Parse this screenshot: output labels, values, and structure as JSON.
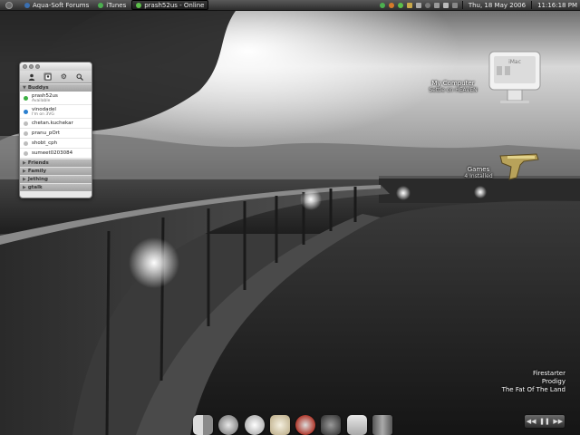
{
  "taskbar": {
    "tasks": [
      {
        "label": "",
        "icon": "gnome-menu-icon",
        "active": false
      },
      {
        "label": "Aqua-Soft Forums",
        "icon": "browser-icon",
        "active": false
      },
      {
        "label": "iTunes",
        "icon": "itunes-icon",
        "active": false
      },
      {
        "label": "prash52us - Online",
        "icon": "messenger-icon",
        "active": true
      }
    ],
    "tray_icons": [
      "network-icon",
      "firefox-icon",
      "messenger-tray-icon",
      "folder-icon",
      "speaker-icon",
      "dashboard-icon",
      "phone-icon",
      "volume-icon",
      "battery-icon"
    ],
    "date": "Thu, 18 May 2006",
    "time": "11:16:18 PM"
  },
  "buddy_window": {
    "groups": {
      "buddies": "Buddys",
      "friends": "Friends",
      "family": "Family",
      "jething": "Jething",
      "gtalk": "gtalk"
    },
    "buddies": [
      {
        "name": "prash52us",
        "status": "Available",
        "color": "#3cb043"
      },
      {
        "name": "vinodadel",
        "status": "I'm on 3VG",
        "color": "#2a7fcf"
      },
      {
        "name": "chetan.kuchekar",
        "status": "",
        "color": "#bdbdbd"
      },
      {
        "name": "pranu_pOrt",
        "status": "",
        "color": "#bdbdbd"
      },
      {
        "name": "shobt_cph",
        "status": "",
        "color": "#bdbdbd"
      },
      {
        "name": "sumeet0203084",
        "status": "",
        "color": "#bdbdbd"
      }
    ]
  },
  "desktop": {
    "computer_icon_label": "iMac",
    "computer_title": "My Computer",
    "computer_subtitle": "Settle on HEAVEN",
    "games_title": "Games",
    "games_subtitle": "4 Installed"
  },
  "dock": {
    "items": [
      "finder-icon",
      "safari-compass-icon",
      "ichat-icon",
      "pidgin-icon",
      "clock-icon",
      "terminal-icon",
      "apple-icon",
      "trash-icon"
    ]
  },
  "now_playing": {
    "artist": "Firestarter",
    "album": "Prodigy",
    "track": "The Fat Of The Land"
  },
  "media_controls": {
    "prev": "◀◀",
    "pause": "❚❚",
    "next": "▶▶"
  },
  "colors": {
    "taskbar": "#3a3a3a",
    "online": "#3cb043",
    "away": "#2a7fcf",
    "offline": "#bdbdbd"
  }
}
